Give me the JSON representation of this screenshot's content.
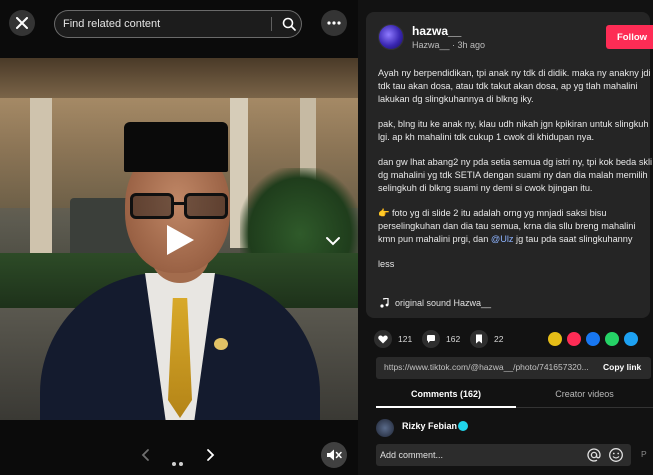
{
  "search": {
    "placeholder": "Find related content"
  },
  "author": {
    "username": "hazwa__",
    "handle": "Hazwa__",
    "separator": " · ",
    "posted_ago": "3h ago",
    "follow_label": "Follow"
  },
  "caption": {
    "p1": "Ayah ny berpendidikan, tpi anak ny tdk di didik. maka ny anakny jdi tdk tau akan dosa, atau tdk takut akan dosa, ap yg tlah mahalini lakukan dg slingkuhannya di blkng iky.",
    "p2": "pak, blng itu ke anak ny, klau udh nikah jgn kpikiran untuk slingkuh lgi. ap kh mahalini tdk cukup 1 cwok di khidupan nya.",
    "p3": "dan gw lhat abang2 ny pda setia semua dg istri ny, tpi kok beda skli dg mahalini yg tdk SETIA dengan suami ny dan dia malah memilih selingkuh di blkng suami ny demi si cwok bjingan itu.",
    "p4_pre": "👉 foto yg di slide 2 itu adalah orng yg mnjadi saksi bisu perselingkuhan dan dia tau semua, krna dia sllu breng mahalini kmn pun mahalini prgi, dan ",
    "p4_tag": "@Ulz",
    "p4_post": " jg tau pda saat slingkuhanny",
    "more": "less"
  },
  "music": {
    "label": "original sound Hazwa__"
  },
  "stats": {
    "likes": "121",
    "comments": "162",
    "saves": "22"
  },
  "share_icons": [
    "tiktok-repost-icon",
    "pocket-icon",
    "facebook-icon",
    "whatsapp-icon",
    "twitter-icon"
  ],
  "link": {
    "url": "https://www.tiktok.com/@hazwa__/photo/741657320...",
    "copy_label": "Copy link"
  },
  "tabs": {
    "comments": "Comments (162)",
    "creator": "Creator videos"
  },
  "comment_preview": {
    "name": "Rizky Febian"
  },
  "comment_bar": {
    "placeholder": "Add comment...",
    "post_label": "P"
  },
  "colors": {
    "follow": "#fe2c55",
    "panel": "#121212",
    "card": "#252525",
    "mention": "#8db3ff"
  }
}
